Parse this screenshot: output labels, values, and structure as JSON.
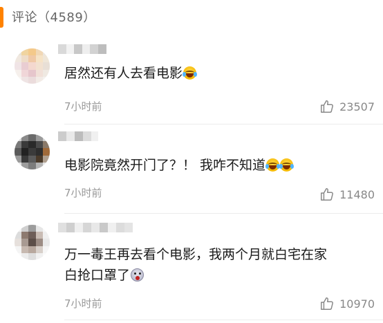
{
  "header": {
    "title": "评论（4589）"
  },
  "comments": [
    {
      "text_before": "居然还有人去看电影",
      "emojis": [
        "laugh-cry"
      ],
      "time": "7小时前",
      "likes": "23507"
    },
    {
      "text_before": "电影院竟然开门了？！ 我咋不知道",
      "emojis": [
        "laugh-cry",
        "laugh-cry"
      ],
      "time": "7小时前",
      "likes": "11480"
    },
    {
      "line1": "万一毒王再去看个电影，我两个月就白宅在家",
      "line2": "白抢口罩了",
      "emojis": [
        "scared"
      ],
      "time": "7小时前",
      "likes": "10970"
    }
  ],
  "colors": {
    "accent": "#ff8200",
    "muted": "#999999",
    "text": "#1a1a1a"
  },
  "icons": {
    "like": "thumbs-up-icon"
  }
}
